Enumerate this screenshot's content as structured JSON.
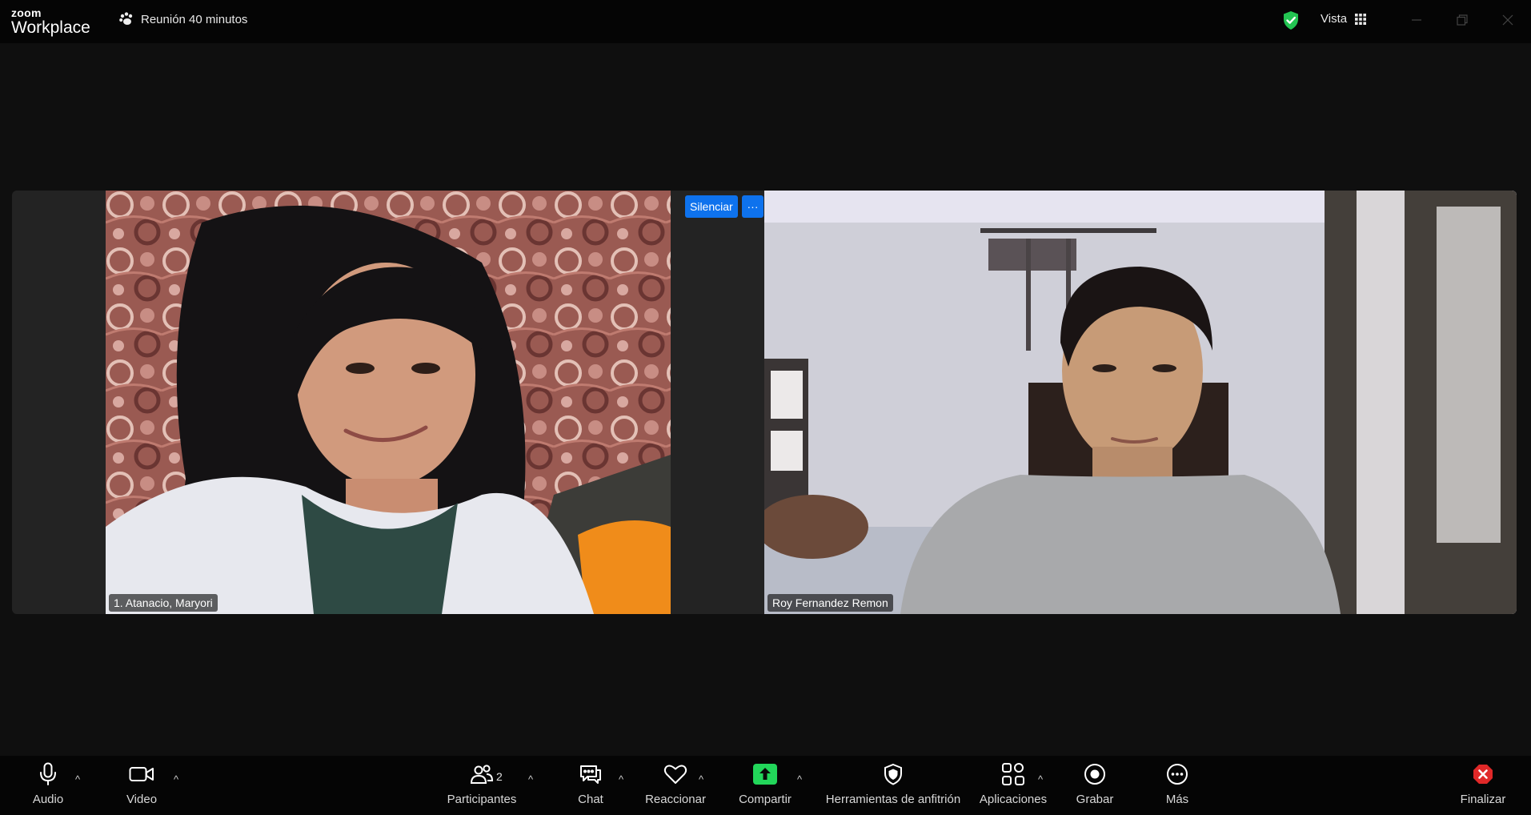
{
  "app": {
    "brand_top": "zoom",
    "brand_bottom": "Workplace"
  },
  "meeting": {
    "title": "Reunión 40 minutos",
    "view_label": "Vista"
  },
  "participants_tiles": [
    {
      "name": "1. Atanacio, Maryori"
    },
    {
      "name": "Roy Fernandez Remon"
    }
  ],
  "tile_controls": {
    "mute_label": "Silenciar",
    "more_label": "···"
  },
  "toolbar": {
    "audio": "Audio",
    "video": "Video",
    "participants": "Participantes",
    "participants_count": "2",
    "chat": "Chat",
    "react": "Reaccionar",
    "share": "Compartir",
    "host_tools": "Herramientas de anfitrión",
    "apps": "Aplicaciones",
    "record": "Grabar",
    "more": "Más",
    "end": "Finalizar"
  },
  "colors": {
    "share_green": "#22d65a",
    "end_red": "#e02828",
    "accent_blue": "#0e72ed",
    "secure_green": "#23c552"
  }
}
